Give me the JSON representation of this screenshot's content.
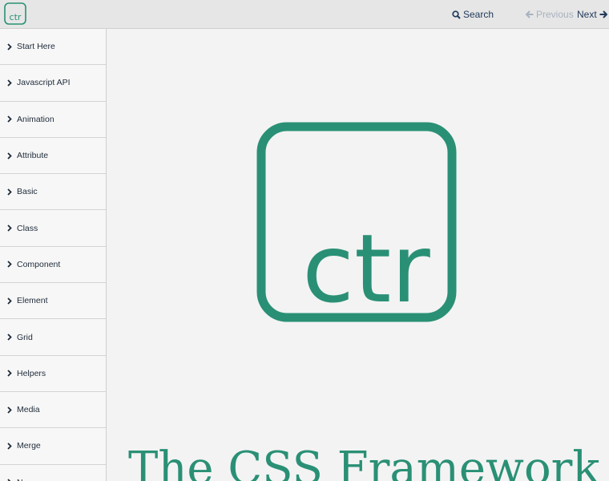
{
  "header": {
    "logo_text": "ctr",
    "search_label": "Search",
    "previous_label": "Previous",
    "next_label": "Next"
  },
  "sidebar": {
    "items": [
      {
        "label": "Start Here"
      },
      {
        "label": "Javascript API"
      },
      {
        "label": "Animation"
      },
      {
        "label": "Attribute"
      },
      {
        "label": "Basic"
      },
      {
        "label": "Class"
      },
      {
        "label": "Component"
      },
      {
        "label": "Element"
      },
      {
        "label": "Grid"
      },
      {
        "label": "Helpers"
      },
      {
        "label": "Media"
      },
      {
        "label": "Merge"
      },
      {
        "label": "N..."
      }
    ]
  },
  "main": {
    "logo_text": "ctr",
    "title": "The CSS Framework"
  },
  "colors": {
    "brand": "#2a9075",
    "nav_text": "#213a5a",
    "disabled": "#a8b2bf"
  }
}
